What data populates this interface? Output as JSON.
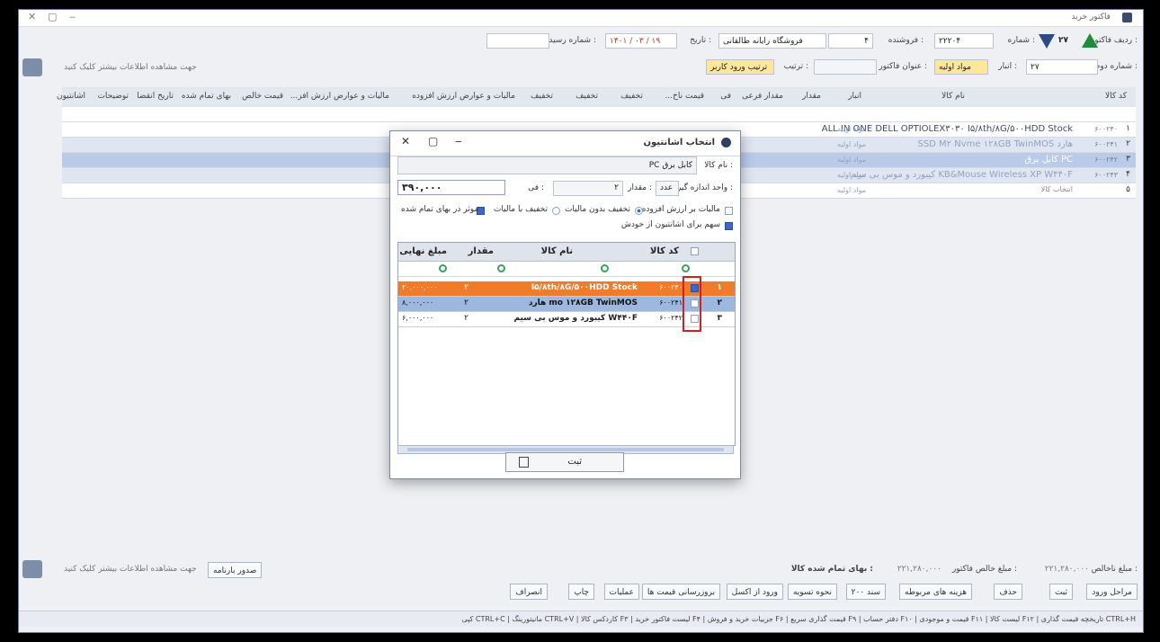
{
  "window": {
    "title": "فاکتور خرید"
  },
  "header": {
    "row_label": "ردیف فاکتور :",
    "number_label": "شماره :",
    "number_value": "۲۷",
    "fiscal_field": "۲۲۲۰۴",
    "seller_label": "فروشنده :",
    "seller_code": "۴",
    "seller_name": "فروشگاه رایانه طالقانی",
    "date_label": "تاریخ :",
    "date_value": "۱۴۰۱ / ۰۳ / ۱۹",
    "receipt_label": "شماره رسید :",
    "row2_label": "شماره دوم :",
    "row2_value": "۲۷",
    "warehouse_label": "انبار :",
    "warehouse_value": "مواد اولیه",
    "invoice_title_label": "عنوان فاکتور :",
    "order_label": "ترتیب :",
    "order_value": "ترتیب ورود کاربر",
    "details_hint": "جهت مشاهده اطلاعات بیشتر کلیک کنید"
  },
  "grid": {
    "columns": [
      "کد کالا",
      "نام کالا",
      "انبار",
      "مقدار",
      "مقدار فرعی",
      "فی",
      "قیمت ناخ...",
      "تخفیف",
      "تخفیف",
      "تخفیف",
      "مالیات و عوارض ارزش افزوده",
      "مالیات و عوارض ارزش افز...",
      "قیمت خالص",
      "بهای تمام شده",
      "تاریخ انقضا",
      "توضیحات",
      "اشانتیون"
    ],
    "rows": [
      {
        "num": "۱",
        "code": "۶۰۰۲۴۰",
        "name": "ALL IN ONE DELL OPTIOLEX۳۰۳۰ I۵/۸th/۸G/۵۰۰HDD Stock",
        "inv": "مواد اولیه"
      },
      {
        "num": "۲",
        "code": "۶۰۰۲۴۱",
        "name": "SSD M۲ Nvme ۱۲۸GB TwinMOS هارد",
        "inv": "مواد اولیه"
      },
      {
        "num": "۳",
        "code": "۶۰۰۲۴۲",
        "name": "کابل برق PC",
        "inv": "مواد اولیه"
      },
      {
        "num": "۴",
        "code": "۶۰۰۲۴۳",
        "name": "کیبورد و موس بی سیم KB&Mouse Wireless XP W۴۴۰F",
        "inv": "مواد اولیه"
      },
      {
        "num": "۵",
        "code": "",
        "name": "انتخاب کالا",
        "inv": "مواد اولیه"
      }
    ]
  },
  "footer": {
    "net_label": "مبلغ ناخالص :",
    "net_value": "۲۲۱,۲۸۰,۰۰۰",
    "total_label": "مبلغ خالص فاکتور :",
    "total_value": "۲۲۱,۲۸۰,۰۰۰",
    "cost_label": "بهای تمام شده کالا :",
    "issue_button": "صدور بارنامه",
    "buttons": [
      "مراحل ورود",
      "ثبت",
      "حذف",
      "هزینه های مربوطه",
      "سند ۲۰۰",
      "نحوه تسویه",
      "ورود از اکسل",
      "بروزرسانی قیمت ها",
      "عملیات",
      "چاپ",
      "انصراف"
    ],
    "shortcuts": "کپی CTRL+C | مانیتورینگ CTRL+V | کاردکس کالا F۳ | لیست فاکتور خرید F۴ | جزییات خرید و فروش F۶ | قیمت گذاری سریع F۹ | دفتر حساب F۱۰ | قیمت و موجودی F۱۱ | لیست کالا F۱۲ | تاریخچه قیمت گذاری CTRL+H"
  },
  "dialog": {
    "title": "انتخاب اشانتیون",
    "product_label": "نام کالا :",
    "product_value": "کابل برق PC",
    "unit_label": "واحد اندازه گیری :",
    "unit_value": "عدد",
    "qty_label": "مقدار :",
    "qty_value": "۲",
    "fee_label": "فی :",
    "fee_value": "۳۹۰,۰۰۰",
    "tax_label": "مالیات بر ارزش افزوده",
    "disc_no_tax": "تخفیف بدون مالیات",
    "disc_tax": "تخفیف با مالیات",
    "effect_cost": "موثر در بهای تمام شده",
    "share_label": "سهم برای اشانتیون از خودش",
    "columns": {
      "code": "کد کالا",
      "name": "نام کالا",
      "qty": "مقدار",
      "final": "مبلغ نهایی"
    },
    "rows": [
      {
        "num": "۱",
        "code": "۶۰۰۲۴۰",
        "name": "I۵/۸th/۸G/۵۰۰HDD Stock",
        "qty": "۲",
        "final": "۲۰,۰۰۰,۰۰۰"
      },
      {
        "num": "۲",
        "code": "۶۰۰۲۴۱",
        "name": "هارد mo ۱۲۸GB TwinMOS",
        "qty": "۲",
        "final": "۸,۰۰۰,۰۰۰"
      },
      {
        "num": "۳",
        "code": "۶۰۰۲۴۲",
        "name": "کیبورد و موس بی سیم W۴۴۰F",
        "qty": "۲",
        "final": "۶,۰۰۰,۰۰۰"
      }
    ],
    "ok_button": "ثبت"
  }
}
